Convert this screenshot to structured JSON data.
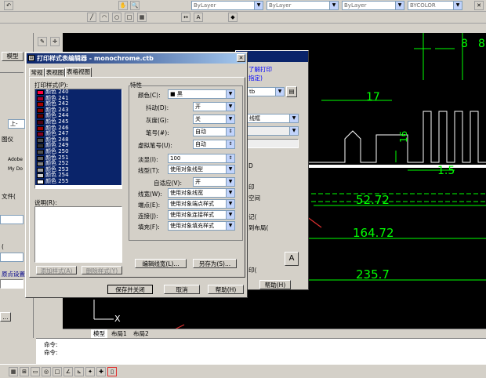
{
  "toolbar": {
    "layer_combo": "ByLayer",
    "linetype_combo": "ByLayer",
    "lineweight_combo": "ByLayer",
    "plotstyle_combo": "BYCOLOR"
  },
  "cad": {
    "dims": [
      "17",
      "16",
      "8",
      "8",
      "1.5",
      "52.72",
      "164.72",
      "235.7"
    ],
    "axis_x": "X",
    "layout_tabs": [
      "模型",
      "布局1",
      "布局2"
    ],
    "command_lines": [
      "命令:",
      "命令:"
    ]
  },
  "left_panel": {
    "tab_model": "模型",
    "items": [
      "上-",
      "图仪",
      "Adobe",
      "My Do",
      "文件(",
      "(",
      "原点设置",
      "..."
    ]
  },
  "back_dialog": {
    "title_partial": "了解打印",
    "link": "指定)",
    "combo_ctb": "tb",
    "combo_style": "线框",
    "labels": [
      "印",
      "空间",
      "记(",
      "到布局(",
      "印(",
      "D",
      "A"
    ],
    "help_button": "帮助(H)"
  },
  "dialog": {
    "title": "打印样式表编辑器 - monochrome.ctb",
    "tabs": [
      "常规",
      "表视图",
      "表格视图"
    ],
    "styles_label": "打印样式(P):",
    "styles": [
      "颜色 240",
      "颜色 241",
      "颜色 242",
      "颜色 243",
      "颜色 244",
      "颜色 245",
      "颜色 246",
      "颜色 247",
      "颜色 248",
      "颜色 249",
      "颜色 250",
      "颜色 251",
      "颜色 252",
      "颜色 253",
      "颜色 254",
      "颜色 255"
    ],
    "style_swatches": [
      "#ff003f",
      "#a5002a",
      "#a50000",
      "#7f0000",
      "#660000",
      "#4c0013",
      "#990000",
      "#800020",
      "#4c4c4c",
      "#333333",
      "#505050",
      "#626262",
      "#808080",
      "#a0a0a0",
      "#d0d0d0",
      "#ffffff"
    ],
    "desc_label": "说明(R):",
    "properties_label": "特性",
    "props": {
      "color_label": "颜色(C):",
      "color_value": "■ 黑",
      "dither_label": "抖动(D):",
      "dither_value": "开",
      "gray_label": "灰度(G):",
      "gray_value": "关",
      "pen_label": "笔号(#):",
      "pen_value": "自动",
      "vpen_label": "虚拟笔号(U):",
      "vpen_value": "自动",
      "screen_label": "淡显(I):",
      "screen_value": "100",
      "linetype_label": "线型(T):",
      "linetype_value": "使用对象线型",
      "adaptive_label": "自适应(V):",
      "adaptive_value": "开",
      "lineweight_label": "线宽(W):",
      "lineweight_value": "使用对象线宽",
      "endstyle_label": "端点(E):",
      "endstyle_value": "使用对象端点样式",
      "joinstyle_label": "连接(J):",
      "joinstyle_value": "使用对象连接样式",
      "fillstyle_label": "填充(F):",
      "fillstyle_value": "使用对象填充样式"
    },
    "btn_add_style": "添加样式(A)",
    "btn_delete_style": "删除样式(Y)",
    "btn_edit_lineweights": "编辑线宽(L)...",
    "btn_save_as": "另存为(S)...",
    "btn_save_close": "保存并关闭",
    "btn_cancel": "取消",
    "btn_help": "帮助(H)"
  },
  "colors": {
    "title_bar": "#0a246a",
    "dimension_green": "#00ff00",
    "annotation_red": "#e03030"
  }
}
